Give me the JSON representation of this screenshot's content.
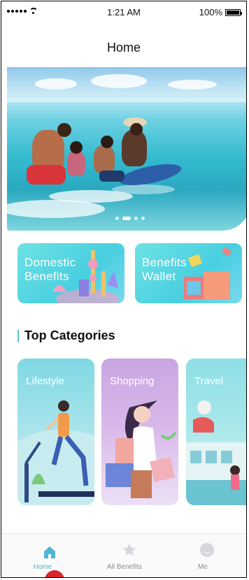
{
  "status_bar": {
    "time": "1:21 AM",
    "battery": "100%"
  },
  "nav": {
    "title": "Home"
  },
  "hero": {
    "carousel_pages": 5,
    "active_page": 2
  },
  "benefit_cards": [
    {
      "label_line1": "Domestic",
      "label_line2": "Benefits"
    },
    {
      "label_line1": "Benefits",
      "label_line2": "Wallet"
    }
  ],
  "section": {
    "title": "Top Categories"
  },
  "categories": [
    {
      "label": "Lifestyle"
    },
    {
      "label": "Shopping"
    },
    {
      "label": "Travel"
    }
  ],
  "tab_bar": {
    "items": [
      {
        "label": "Home",
        "icon": "home-icon",
        "active": true
      },
      {
        "label": "All Benefits",
        "icon": "star-icon",
        "active": false
      },
      {
        "label": "Me",
        "icon": "user-icon",
        "active": false
      }
    ]
  },
  "colors": {
    "accent": "#4fb6d3",
    "card_teal": "#48cfe0",
    "shopping_purple": "#c9a6e2",
    "indicator_red": "#d9242f"
  }
}
